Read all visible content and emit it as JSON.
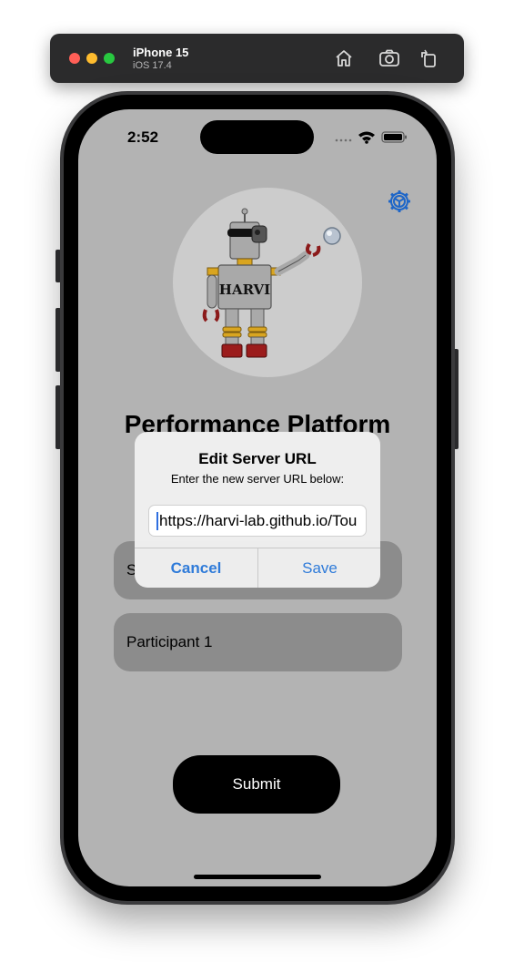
{
  "simulator": {
    "device_name": "iPhone 15",
    "os_version": "iOS 17.4",
    "icons": [
      "home-icon",
      "screenshot-icon",
      "rotate-icon"
    ]
  },
  "status_bar": {
    "time": "2:52",
    "icons": [
      "cellular-icon",
      "wifi-icon",
      "battery-icon"
    ]
  },
  "header": {
    "settings_icon": "gear-icon"
  },
  "logo": {
    "badge_text": "HARVI"
  },
  "page": {
    "title": "Performance Platform"
  },
  "form": {
    "server_field_partial": "S",
    "participant_value": "Participant 1",
    "submit_label": "Submit"
  },
  "alert": {
    "title": "Edit Server URL",
    "message": "Enter the new server URL below:",
    "input_value": "https://harvi-lab.github.io/Tou",
    "cancel_label": "Cancel",
    "save_label": "Save"
  },
  "colors": {
    "screen_bg": "#b3b3b3",
    "accent_blue": "#2f7bd9",
    "field_bg": "#8c8c8c",
    "button_bg": "#000000"
  }
}
